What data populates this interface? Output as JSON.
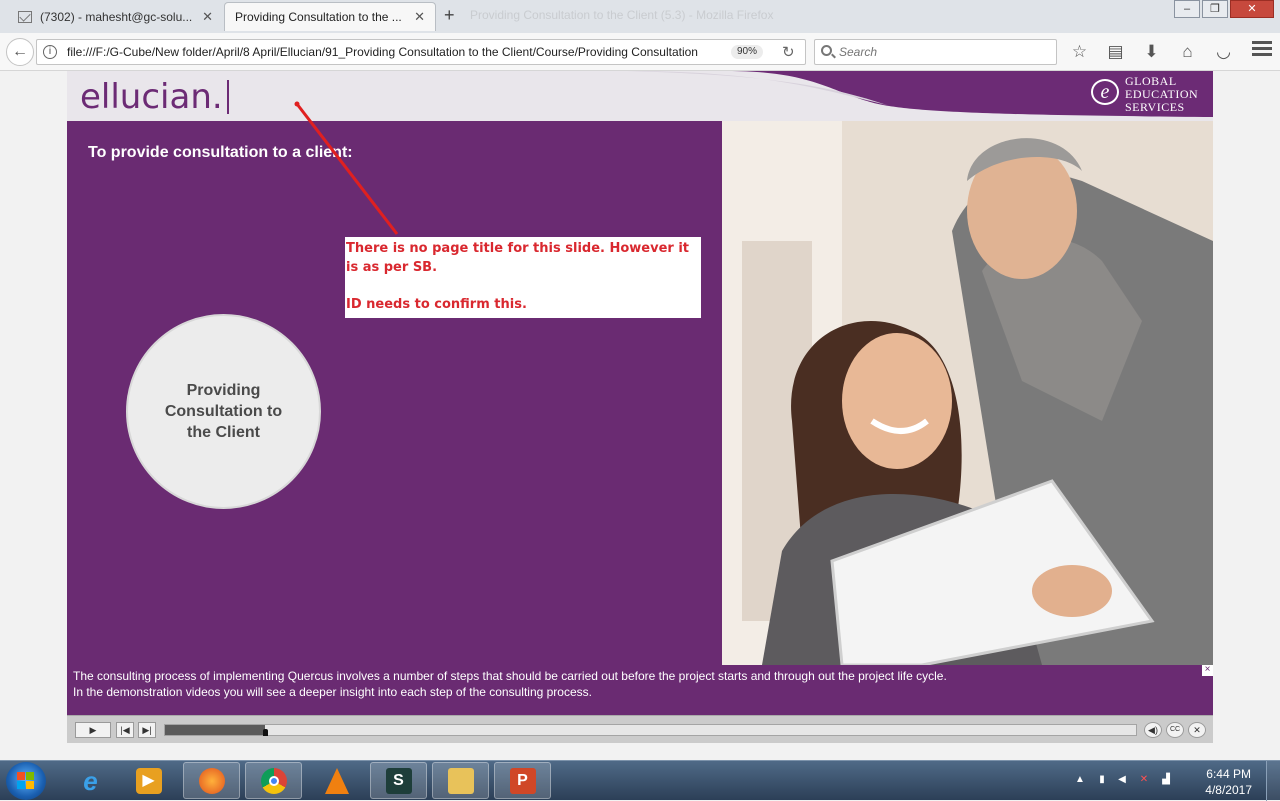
{
  "browser": {
    "tabs": [
      {
        "title": "(7302) - mahesht@gc-solu...",
        "active": false,
        "icon": "mail-icon"
      },
      {
        "title": "Providing Consultation to the ...",
        "active": true
      }
    ],
    "ghost_title": "Providing Consultation to the Client (5.3) - Mozilla Firefox",
    "url": "file:///F:/G-Cube/New folder/April/8 April/Ellucian/91_Providing Consultation to the Client/Course/Providing Consultation",
    "zoom": "90%",
    "search_placeholder": "Search",
    "toolbar_icons": [
      "bookmark-star-icon",
      "reading-list-icon",
      "download-icon",
      "home-icon",
      "pocket-icon"
    ]
  },
  "course": {
    "logo": "ellucian.",
    "partner_logo": {
      "mark": "e",
      "lines": [
        "GLOBAL",
        "EDUCATION",
        "SERVICES"
      ]
    },
    "heading": "To provide consultation to a client:",
    "circle_label": "Providing Consultation to the Client",
    "caption_lines": [
      "The consulting process of implementing Quercus involves a number of steps that should be carried out before the project starts and through out the project life cycle.",
      "In the demonstration videos you will see a deeper insight into each step of the consulting process."
    ],
    "caption_close": "×",
    "colors": {
      "brand_purple": "#6a2b72",
      "annotation_red": "#d9282f"
    }
  },
  "annotation": {
    "line1": "There is no page title for this slide. However it is as per SB.",
    "line2": "ID needs to confirm this."
  },
  "player": {
    "progress_fraction": 0.103,
    "buttons": {
      "play": "▶",
      "prev": "|◀",
      "next": "▶|",
      "volume": "◀)",
      "cc": "CC",
      "close": "✕"
    }
  },
  "taskbar": {
    "time": "6:44 PM",
    "date": "4/8/2017",
    "apps": [
      "internet-explorer-icon",
      "media-player-icon",
      "firefox-icon",
      "chrome-icon",
      "vlc-icon",
      "snagit-icon",
      "file-explorer-icon",
      "powerpoint-icon"
    ]
  }
}
